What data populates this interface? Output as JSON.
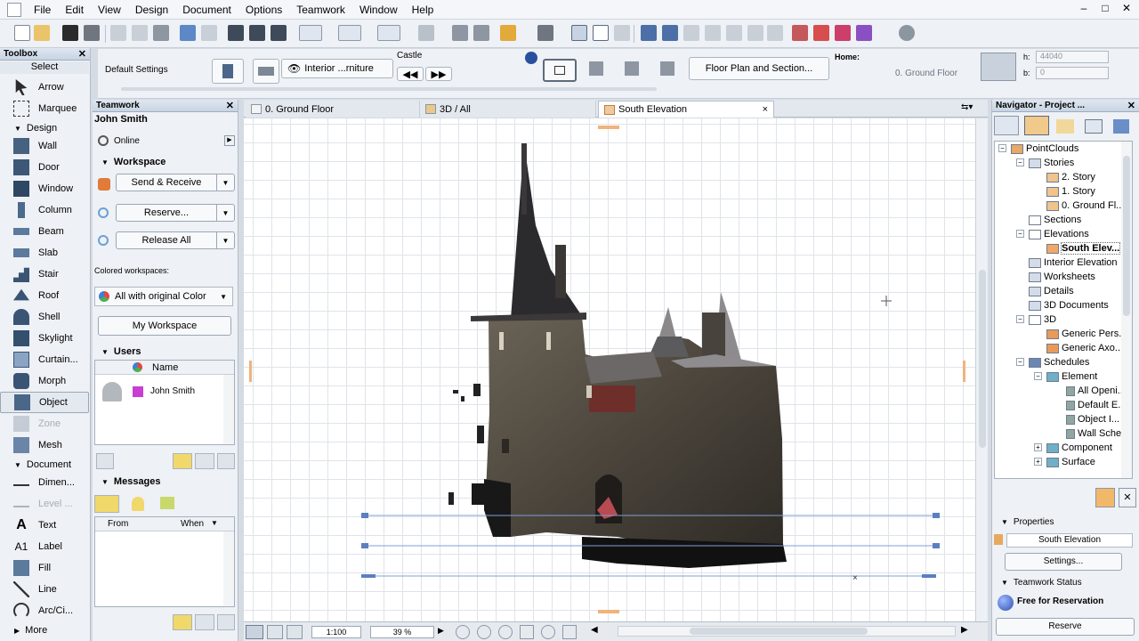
{
  "menu": [
    "File",
    "Edit",
    "View",
    "Design",
    "Document",
    "Options",
    "Teamwork",
    "Window",
    "Help"
  ],
  "window_controls": [
    "–",
    "□",
    "✕"
  ],
  "colors": {
    "accent": "#e38a2e",
    "panel": "#eef1f5",
    "grid": "#dfe4ea",
    "selection": "#5b7fbf",
    "online": "#4f8ad8"
  },
  "toolbox": {
    "title": "Toolbox",
    "select_label": "Select",
    "tools_select": [
      {
        "label": "Arrow",
        "icon": "arrow-icon"
      },
      {
        "label": "Marquee",
        "icon": "marquee-icon"
      }
    ],
    "group_design": "Design",
    "tools_design": [
      {
        "label": "Wall",
        "icon": "wall-icon"
      },
      {
        "label": "Door",
        "icon": "door-icon"
      },
      {
        "label": "Window",
        "icon": "window-icon"
      },
      {
        "label": "Column",
        "icon": "column-icon"
      },
      {
        "label": "Beam",
        "icon": "beam-icon"
      },
      {
        "label": "Slab",
        "icon": "slab-icon"
      },
      {
        "label": "Stair",
        "icon": "stair-icon"
      },
      {
        "label": "Roof",
        "icon": "roof-icon"
      },
      {
        "label": "Shell",
        "icon": "shell-icon"
      },
      {
        "label": "Skylight",
        "icon": "skylight-icon"
      },
      {
        "label": "Curtain...",
        "icon": "curtain-wall-icon"
      },
      {
        "label": "Morph",
        "icon": "morph-icon"
      },
      {
        "label": "Object",
        "icon": "object-icon"
      },
      {
        "label": "Zone",
        "icon": "zone-icon"
      },
      {
        "label": "Mesh",
        "icon": "mesh-icon"
      }
    ],
    "group_document": "Document",
    "tools_document": [
      {
        "label": "Dimen...",
        "icon": "dimension-icon"
      },
      {
        "label": "Level ...",
        "icon": "level-icon"
      },
      {
        "label": "Text",
        "icon": "text-icon"
      },
      {
        "label": "Label",
        "icon": "label-icon"
      },
      {
        "label": "Fill",
        "icon": "fill-icon"
      },
      {
        "label": "Line",
        "icon": "line-icon"
      },
      {
        "label": "Arc/Ci...",
        "icon": "arc-icon"
      }
    ],
    "more_label": "More"
  },
  "infobox": {
    "default_settings": "Default Settings",
    "layer_combo": "Interior ...rniture",
    "layer_name": "Castle",
    "floor_plan_button": "Floor Plan and Section...",
    "home_label": "Home:",
    "home_story": "0. Ground Floor",
    "h_label": "h:",
    "h_value": "44040",
    "b_label": "b:",
    "b_value": "0"
  },
  "teamwork": {
    "title": "Teamwork",
    "user": "John Smith",
    "status": "Online",
    "workspace_header": "Workspace",
    "send_receive": "Send & Receive",
    "reserve": "Reserve...",
    "release_all": "Release All",
    "colored_label": "Colored workspaces:",
    "color_option": "All with original Color",
    "my_workspace": "My Workspace",
    "users_header": "Users",
    "users_col_name": "Name",
    "users": [
      {
        "name": "John Smith",
        "color": "#c93fd3"
      }
    ],
    "messages_header": "Messages",
    "msg_col_from": "From",
    "msg_col_when": "When"
  },
  "tabs": [
    {
      "label": "0. Ground Floor",
      "icon": "floor-plan-icon"
    },
    {
      "label": "3D / All",
      "icon": "3d-icon"
    },
    {
      "label": "South Elevation",
      "icon": "elevation-icon",
      "close": "×"
    }
  ],
  "statusbar": {
    "scale": "1:100",
    "zoom": "39 %"
  },
  "navigator": {
    "title": "Navigator - Project ...",
    "tree": [
      {
        "label": "PointClouds",
        "icon": "project-icon"
      },
      {
        "label": "Stories",
        "icon": "stories-icon"
      },
      {
        "label": "2. Story",
        "icon": "story-icon"
      },
      {
        "label": "1. Story",
        "icon": "story-icon"
      },
      {
        "label": "0. Ground Fl...",
        "icon": "story-icon"
      },
      {
        "label": "Sections",
        "icon": "section-icon"
      },
      {
        "label": "Elevations",
        "icon": "elevation-icon"
      },
      {
        "label": "South Elev...",
        "icon": "elevation-icon"
      },
      {
        "label": "Interior Elevation",
        "icon": "interior-elevation-icon"
      },
      {
        "label": "Worksheets",
        "icon": "worksheet-icon"
      },
      {
        "label": "Details",
        "icon": "detail-icon"
      },
      {
        "label": "3D Documents",
        "icon": "3d-document-icon"
      },
      {
        "label": "3D",
        "icon": "3d-icon"
      },
      {
        "label": "Generic Pers...",
        "icon": "perspective-icon"
      },
      {
        "label": "Generic Axo...",
        "icon": "axonometry-icon"
      },
      {
        "label": "Schedules",
        "icon": "schedule-icon"
      },
      {
        "label": "Element",
        "icon": "element-icon"
      },
      {
        "label": "All Openi...",
        "icon": "list-icon"
      },
      {
        "label": "Default E...",
        "icon": "list-icon"
      },
      {
        "label": "Object I...",
        "icon": "list-icon"
      },
      {
        "label": "Wall Sche...",
        "icon": "list-icon"
      },
      {
        "label": "Component",
        "icon": "component-icon"
      },
      {
        "label": "Surface",
        "icon": "surface-icon"
      }
    ],
    "properties_header": "Properties",
    "properties_value": "South Elevation",
    "settings_button": "Settings...",
    "teamwork_status_header": "Teamwork Status",
    "reservation_status": "Free for Reservation",
    "reserve_button": "Reserve"
  }
}
